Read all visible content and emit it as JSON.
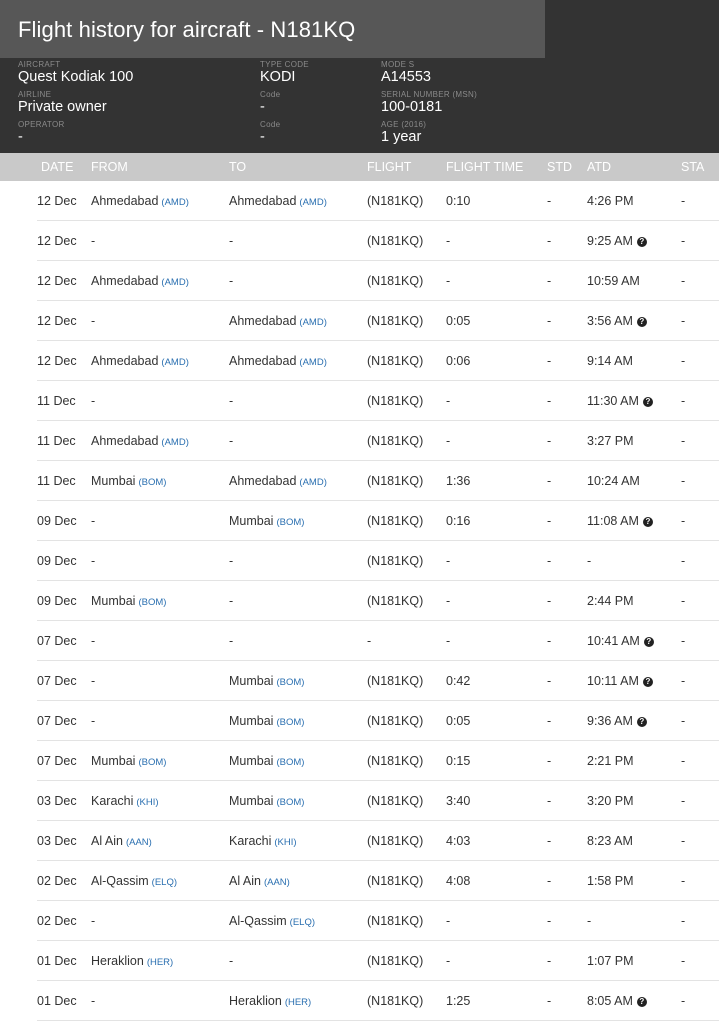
{
  "page": {
    "title": "Flight history for aircraft - N181KQ"
  },
  "aircraft_info": {
    "aircraft_label": "AIRCRAFT",
    "aircraft": "Quest Kodiak 100",
    "airline_label": "AIRLINE",
    "airline": "Private owner",
    "operator_label": "OPERATOR",
    "operator": "-",
    "type_code_label": "TYPE CODE",
    "type_code": "KODI",
    "airline_code_label": "Code",
    "airline_code": "-",
    "operator_code_label": "Code",
    "operator_code": "-",
    "mode_s_label": "MODE S",
    "mode_s": "A14553",
    "serial_label": "SERIAL NUMBER (MSN)",
    "serial": "100-0181",
    "age_label": "AGE (2016)",
    "age": "1 year"
  },
  "table": {
    "columns": [
      "DATE",
      "FROM",
      "TO",
      "FLIGHT",
      "FLIGHT TIME",
      "STD",
      "ATD",
      "STA"
    ],
    "help_icon": "question-circle-icon",
    "code_color": "#2a6fb0",
    "rows": [
      {
        "date": "12 Dec",
        "from": "Ahmedabad",
        "from_code": "(AMD)",
        "to": "Ahmedabad",
        "to_code": "(AMD)",
        "flight": "(N181KQ)",
        "flight_time": "0:10",
        "std": "-",
        "atd": "4:26 PM",
        "atd_help": false,
        "sta": "-"
      },
      {
        "date": "12 Dec",
        "from": "-",
        "from_code": "",
        "to": "-",
        "to_code": "",
        "flight": "(N181KQ)",
        "flight_time": "-",
        "std": "-",
        "atd": "9:25 AM",
        "atd_help": true,
        "sta": "-"
      },
      {
        "date": "12 Dec",
        "from": "Ahmedabad",
        "from_code": "(AMD)",
        "to": "-",
        "to_code": "",
        "flight": "(N181KQ)",
        "flight_time": "-",
        "std": "-",
        "atd": "10:59 AM",
        "atd_help": false,
        "sta": "-"
      },
      {
        "date": "12 Dec",
        "from": "-",
        "from_code": "",
        "to": "Ahmedabad",
        "to_code": "(AMD)",
        "flight": "(N181KQ)",
        "flight_time": "0:05",
        "std": "-",
        "atd": "3:56 AM",
        "atd_help": true,
        "sta": "-"
      },
      {
        "date": "12 Dec",
        "from": "Ahmedabad",
        "from_code": "(AMD)",
        "to": "Ahmedabad",
        "to_code": "(AMD)",
        "flight": "(N181KQ)",
        "flight_time": "0:06",
        "std": "-",
        "atd": "9:14 AM",
        "atd_help": false,
        "sta": "-"
      },
      {
        "date": "11 Dec",
        "from": "-",
        "from_code": "",
        "to": "-",
        "to_code": "",
        "flight": "(N181KQ)",
        "flight_time": "-",
        "std": "-",
        "atd": "11:30 AM",
        "atd_help": true,
        "sta": "-"
      },
      {
        "date": "11 Dec",
        "from": "Ahmedabad",
        "from_code": "(AMD)",
        "to": "-",
        "to_code": "",
        "flight": "(N181KQ)",
        "flight_time": "-",
        "std": "-",
        "atd": "3:27 PM",
        "atd_help": false,
        "sta": "-"
      },
      {
        "date": "11 Dec",
        "from": "Mumbai",
        "from_code": "(BOM)",
        "to": "Ahmedabad",
        "to_code": "(AMD)",
        "flight": "(N181KQ)",
        "flight_time": "1:36",
        "std": "-",
        "atd": "10:24 AM",
        "atd_help": false,
        "sta": "-"
      },
      {
        "date": "09 Dec",
        "from": "-",
        "from_code": "",
        "to": "Mumbai",
        "to_code": "(BOM)",
        "flight": "(N181KQ)",
        "flight_time": "0:16",
        "std": "-",
        "atd": "11:08 AM",
        "atd_help": true,
        "sta": "-"
      },
      {
        "date": "09 Dec",
        "from": "-",
        "from_code": "",
        "to": "-",
        "to_code": "",
        "flight": "(N181KQ)",
        "flight_time": "-",
        "std": "-",
        "atd": "-",
        "atd_help": false,
        "sta": "-"
      },
      {
        "date": "09 Dec",
        "from": "Mumbai",
        "from_code": "(BOM)",
        "to": "-",
        "to_code": "",
        "flight": "(N181KQ)",
        "flight_time": "-",
        "std": "-",
        "atd": "2:44 PM",
        "atd_help": false,
        "sta": "-"
      },
      {
        "date": "07 Dec",
        "from": "-",
        "from_code": "",
        "to": "-",
        "to_code": "",
        "flight": "-",
        "flight_time": "-",
        "std": "-",
        "atd": "10:41 AM",
        "atd_help": true,
        "sta": "-"
      },
      {
        "date": "07 Dec",
        "from": "-",
        "from_code": "",
        "to": "Mumbai",
        "to_code": "(BOM)",
        "flight": "(N181KQ)",
        "flight_time": "0:42",
        "std": "-",
        "atd": "10:11 AM",
        "atd_help": true,
        "sta": "-"
      },
      {
        "date": "07 Dec",
        "from": "-",
        "from_code": "",
        "to": "Mumbai",
        "to_code": "(BOM)",
        "flight": "(N181KQ)",
        "flight_time": "0:05",
        "std": "-",
        "atd": "9:36 AM",
        "atd_help": true,
        "sta": "-"
      },
      {
        "date": "07 Dec",
        "from": "Mumbai",
        "from_code": "(BOM)",
        "to": "Mumbai",
        "to_code": "(BOM)",
        "flight": "(N181KQ)",
        "flight_time": "0:15",
        "std": "-",
        "atd": "2:21 PM",
        "atd_help": false,
        "sta": "-"
      },
      {
        "date": "03 Dec",
        "from": "Karachi",
        "from_code": "(KHI)",
        "to": "Mumbai",
        "to_code": "(BOM)",
        "flight": "(N181KQ)",
        "flight_time": "3:40",
        "std": "-",
        "atd": "3:20 PM",
        "atd_help": false,
        "sta": "-"
      },
      {
        "date": "03 Dec",
        "from": "Al Ain",
        "from_code": "(AAN)",
        "to": "Karachi",
        "to_code": "(KHI)",
        "flight": "(N181KQ)",
        "flight_time": "4:03",
        "std": "-",
        "atd": "8:23 AM",
        "atd_help": false,
        "sta": "-"
      },
      {
        "date": "02 Dec",
        "from": "Al-Qassim",
        "from_code": "(ELQ)",
        "to": "Al Ain",
        "to_code": "(AAN)",
        "flight": "(N181KQ)",
        "flight_time": "4:08",
        "std": "-",
        "atd": "1:58 PM",
        "atd_help": false,
        "sta": "-"
      },
      {
        "date": "02 Dec",
        "from": "-",
        "from_code": "",
        "to": "Al-Qassim",
        "to_code": "(ELQ)",
        "flight": "(N181KQ)",
        "flight_time": "-",
        "std": "-",
        "atd": "-",
        "atd_help": false,
        "sta": "-"
      },
      {
        "date": "01 Dec",
        "from": "Heraklion",
        "from_code": "(HER)",
        "to": "-",
        "to_code": "",
        "flight": "(N181KQ)",
        "flight_time": "-",
        "std": "-",
        "atd": "1:07 PM",
        "atd_help": false,
        "sta": "-"
      },
      {
        "date": "01 Dec",
        "from": "-",
        "from_code": "",
        "to": "Heraklion",
        "to_code": "(HER)",
        "flight": "(N181KQ)",
        "flight_time": "1:25",
        "std": "-",
        "atd": "8:05 AM",
        "atd_help": true,
        "sta": "-"
      }
    ]
  }
}
